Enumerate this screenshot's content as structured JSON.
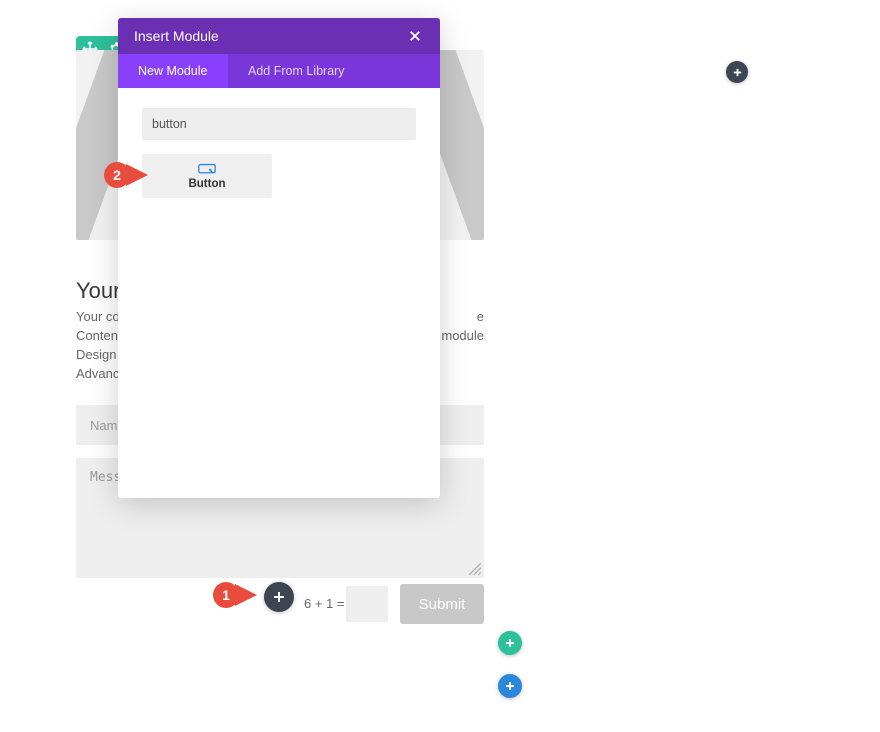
{
  "colors": {
    "teal": "#2cc19a",
    "purple_dark": "#6b2fb3",
    "purple": "#8a3ffc",
    "purple_dim": "#7a36db",
    "blue": "#2b87da",
    "dark": "#3d4452",
    "red": "#e84c3d"
  },
  "toolbar": {
    "move": "move",
    "settings": "settings"
  },
  "bg": {
    "heading": "Your T",
    "desc_line1": "Your cor",
    "desc_line1_right": "e",
    "desc_line2": "Content",
    "desc_line2_right": "module",
    "desc_line3": "Design s",
    "desc_line4": "Advance",
    "name_placeholder": "Name",
    "message_placeholder": "Messa",
    "captcha_label": "6 + 1 =",
    "submit_label": "Submit"
  },
  "modal": {
    "title": "Insert Module",
    "tabs": {
      "new": "New Module",
      "library": "Add From Library"
    },
    "search_value": "button",
    "result": {
      "label": "Button"
    }
  },
  "annotations": {
    "one": "1",
    "two": "2"
  }
}
